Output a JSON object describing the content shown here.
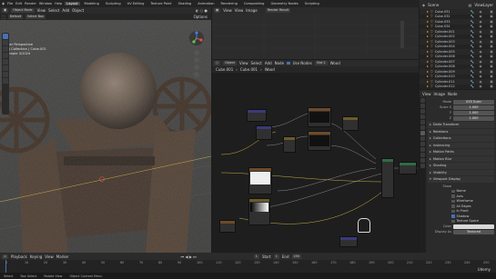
{
  "topbar": {
    "menus": [
      "File",
      "Edit",
      "Render",
      "Window",
      "Help"
    ],
    "workspaces": [
      "Layout",
      "Modeling",
      "Sculpting",
      "UV Editing",
      "Texture Paint",
      "Shading",
      "Animation",
      "Rendering",
      "Compositing",
      "Geometry Nodes",
      "Scripting"
    ],
    "active_workspace": "Layout",
    "scene_label": "Scene",
    "view_layer_label": "ViewLayer"
  },
  "viewport": {
    "mode": "Object Mode",
    "menus": [
      "View",
      "Select",
      "Add",
      "Object"
    ],
    "orientation": "Default",
    "drag": "Select Box",
    "options_label": "Options",
    "info_line1": "User Perspective",
    "info_line2": "(1) Collection | Cube.001",
    "info_line3": "Sample 3/1024"
  },
  "image_editor": {
    "menus": [
      "View",
      "View",
      "Image"
    ],
    "image_name": "Render Result",
    "slot": "Slot 1",
    "layer": "View Layer",
    "pass": "Composite"
  },
  "node_editor": {
    "type_label": "Object",
    "menus": [
      "View",
      "Select",
      "Add",
      "Node"
    ],
    "use_nodes": "Use Nodes",
    "slot": "Slot 2",
    "material": "Wood",
    "breadcrumb": [
      "Cube.001",
      "Cube.001",
      "Wood"
    ]
  },
  "outliner": {
    "items": [
      "Cube.031",
      "Cube.032",
      "Cube.033",
      "Cube.034",
      "Cylinder.001",
      "Cylinder.002",
      "Cylinder.003",
      "Cylinder.004",
      "Cylinder.005",
      "Cylinder.006",
      "Cylinder.007",
      "Cylinder.008",
      "Cylinder.009",
      "Cylinder.010",
      "Cylinder.011",
      "Cylinder.012"
    ]
  },
  "properties": {
    "header_menus": [
      "View",
      "Image",
      "Node"
    ],
    "mode_label": "Mode",
    "mode_value": "XYZ Euler",
    "scale_label": "Scale X",
    "scale_values": [
      "1.000",
      "1.000",
      "1.000"
    ],
    "scale_axes": [
      "Y",
      "Z"
    ],
    "sections": [
      "Delta Transform",
      "Relations",
      "Collections",
      "Instancing",
      "Motion Paths",
      "Motion Blur",
      "Shading",
      "Visibility",
      "Viewport Display"
    ],
    "show_label": "Show",
    "checks": [
      {
        "label": "Name",
        "on": false
      },
      {
        "label": "Axis",
        "on": false
      },
      {
        "label": "Wireframe",
        "on": false
      },
      {
        "label": "All Edges",
        "on": false
      },
      {
        "label": "In Front",
        "on": false
      },
      {
        "label": "Shadow",
        "on": true
      },
      {
        "label": "Texture Space",
        "on": false
      }
    ],
    "color_label": "Color",
    "display_as_label": "Display As",
    "display_as_value": "Textured"
  },
  "timeline": {
    "menus": [
      "Playback",
      "Keying",
      "View",
      "Marker"
    ],
    "start_label": "Start",
    "start_value": "1",
    "end_label": "End",
    "end_value": "250",
    "current_frame": "1",
    "ticks": [
      "0",
      "10",
      "20",
      "30",
      "40",
      "50",
      "60",
      "70",
      "80",
      "90",
      "100",
      "110",
      "120",
      "130",
      "140",
      "150",
      "160",
      "170",
      "180",
      "190",
      "200",
      "210",
      "220",
      "230",
      "240",
      "250"
    ]
  },
  "statusbar": {
    "items": [
      "Select",
      "Box Select",
      "Rotate View",
      "Object Context Menu"
    ]
  },
  "watermark": "Udemy",
  "colors": {
    "accent": "#4772b3",
    "orange": "#ee8f3a",
    "wood": "#6b4f3a"
  }
}
